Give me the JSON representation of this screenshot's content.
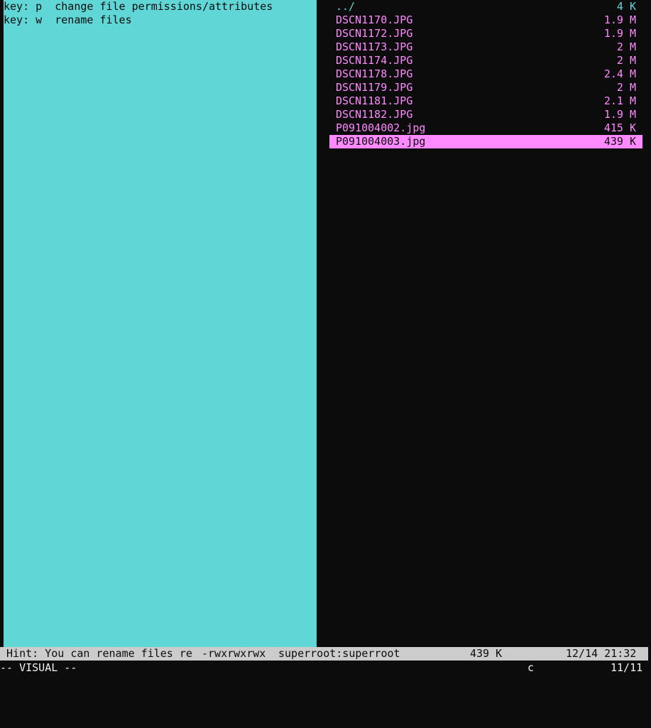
{
  "help": {
    "lines": [
      "key: p  change file permissions/attributes",
      "key: w  rename files"
    ]
  },
  "files": [
    {
      "name": "../",
      "size": "4 K",
      "color": "#61d6d6"
    },
    {
      "name": "DSCN1170.JPG",
      "size": "1.9 M",
      "color": "#ff89ff"
    },
    {
      "name": "DSCN1172.JPG",
      "size": "1.9 M",
      "color": "#ff89ff"
    },
    {
      "name": "DSCN1173.JPG",
      "size": "2 M",
      "color": "#ff89ff"
    },
    {
      "name": "DSCN1174.JPG",
      "size": "2 M",
      "color": "#ff89ff"
    },
    {
      "name": "DSCN1178.JPG",
      "size": "2.4 M",
      "color": "#ff89ff"
    },
    {
      "name": "DSCN1179.JPG",
      "size": "2 M",
      "color": "#ff89ff"
    },
    {
      "name": "DSCN1181.JPG",
      "size": "2.1 M",
      "color": "#ff89ff"
    },
    {
      "name": "DSCN1182.JPG",
      "size": "1.9 M",
      "color": "#ff89ff"
    },
    {
      "name": "P091004002.jpg",
      "size": "415 K",
      "color": "#ff89ff"
    },
    {
      "name": "P091004003.jpg",
      "size": "439 K",
      "color": "#ff89ff",
      "selected": true
    }
  ],
  "status": {
    "hint": " Hint: You can rename files re",
    "permissions": "-rwxrwxrwx",
    "owner": "superroot:superroot",
    "size": "439 K",
    "datetime": "12/14 21:32"
  },
  "cmdline": {
    "mode": "-- VISUAL --",
    "key": "c",
    "position": "11/11"
  },
  "colors": {
    "background": "#0c0c0c",
    "left_pane": "#61d6d6",
    "file_fg": "#ff89ff",
    "selected_bg": "#ff89ff",
    "statusbar_bg": "#cccccc"
  }
}
